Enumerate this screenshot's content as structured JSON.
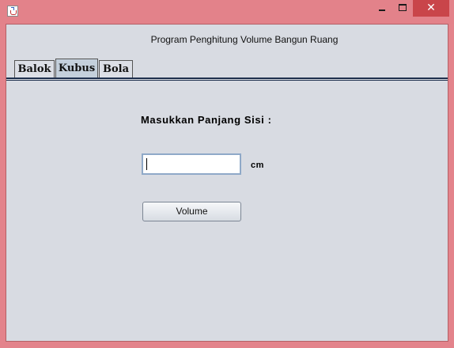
{
  "window": {
    "title": "",
    "app_icon": "java-cup-icon",
    "controls": {
      "minimize_icon": "minimize-icon",
      "maximize_icon": "maximize-icon",
      "close_label": "✕"
    }
  },
  "app": {
    "header": "Program Penghitung Volume Bangun Ruang",
    "tabs": [
      {
        "label": "Balok",
        "active": false
      },
      {
        "label": "Kubus",
        "active": true
      },
      {
        "label": "Bola",
        "active": false
      }
    ],
    "form": {
      "prompt": "Masukkan Panjang Sisi :",
      "input_value": "",
      "unit": "cm",
      "button_label": "Volume"
    }
  },
  "colors": {
    "frame": "#e3838b",
    "client_bg": "#d8dbe2",
    "active_tab": "#c4d0dc",
    "close_button": "#c9454a",
    "tab_line": "#1e2f4d"
  }
}
